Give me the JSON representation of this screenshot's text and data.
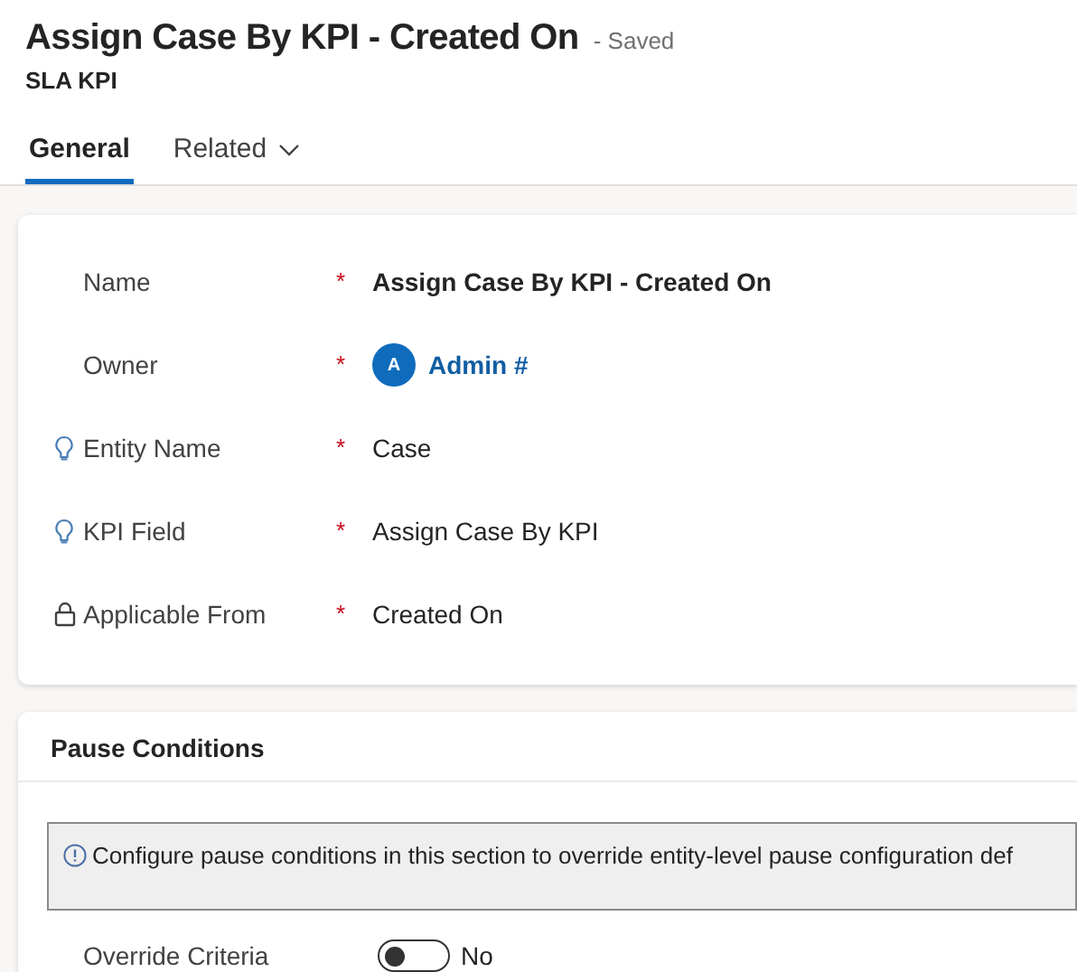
{
  "header": {
    "title": "Assign Case By KPI - Created On",
    "status": "- Saved",
    "entity": "SLA KPI"
  },
  "tabs": [
    {
      "label": "General",
      "selected": true,
      "dropdown": false
    },
    {
      "label": "Related",
      "selected": false,
      "dropdown": true
    }
  ],
  "required_mark": "*",
  "fields": [
    {
      "label": "Name",
      "required": true,
      "recommended": false,
      "locked": false,
      "kind": "bold",
      "value": "Assign Case By KPI - Created On"
    },
    {
      "label": "Owner",
      "required": true,
      "recommended": false,
      "locked": false,
      "kind": "lookup",
      "avatar": "A",
      "value": "Admin #"
    },
    {
      "label": "Entity Name",
      "required": true,
      "recommended": true,
      "locked": false,
      "kind": "plain",
      "value": "Case"
    },
    {
      "label": "KPI Field",
      "required": true,
      "recommended": true,
      "locked": false,
      "kind": "plain",
      "value": "Assign Case By KPI"
    },
    {
      "label": "Applicable From",
      "required": true,
      "recommended": false,
      "locked": true,
      "kind": "plain",
      "value": "Created On"
    }
  ],
  "pause_section": {
    "title": "Pause Conditions",
    "notice": "Configure pause conditions in this section to override entity-level pause configuration def",
    "toggle": {
      "label": "Override Criteria",
      "on": false,
      "text": "No"
    }
  }
}
